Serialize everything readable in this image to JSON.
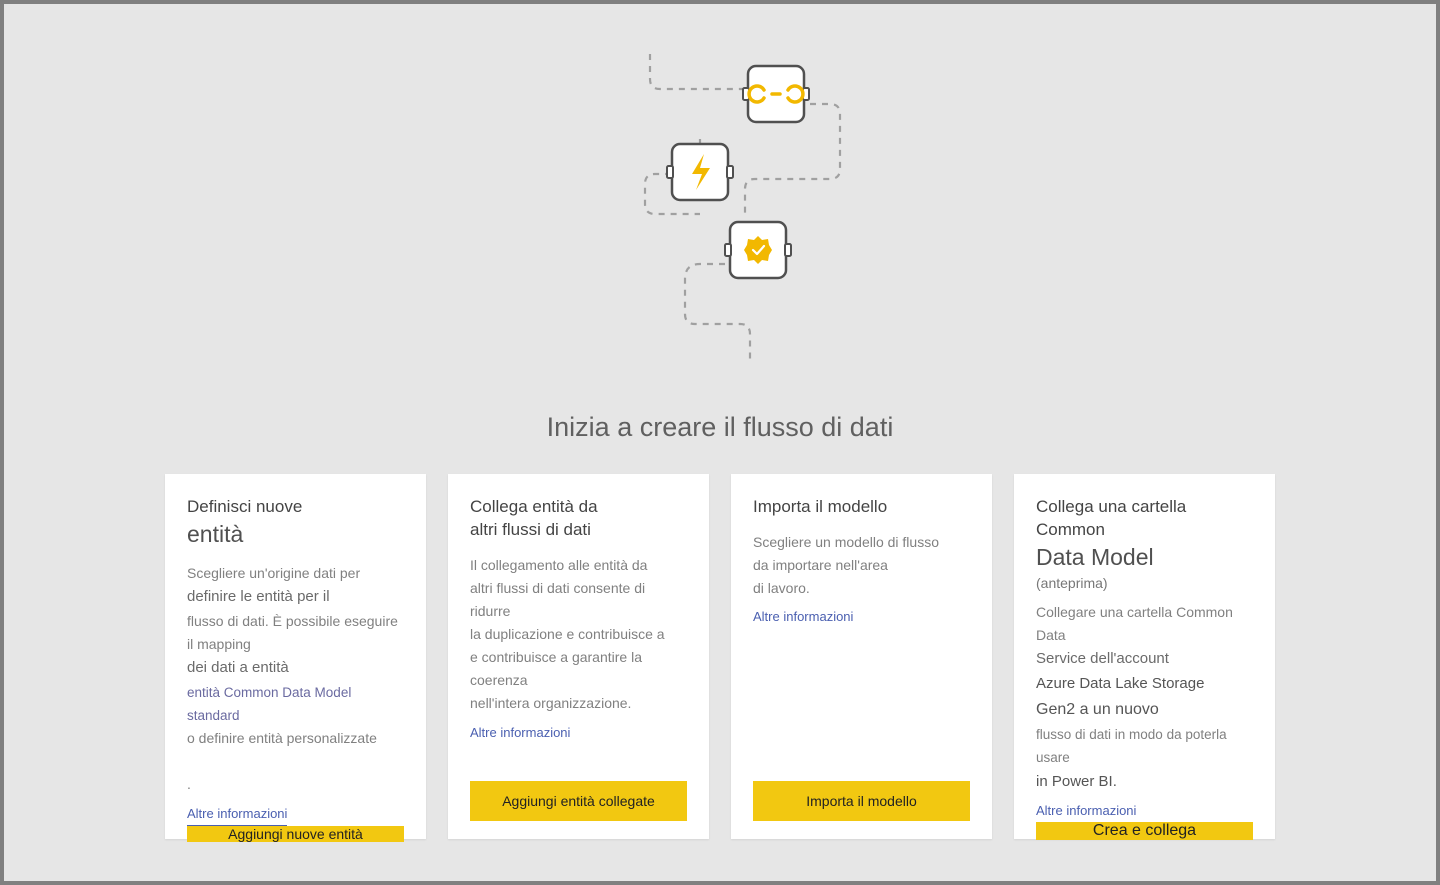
{
  "page_title": "Inizia a creare il flusso di dati",
  "learn_more_label": "Altre informazioni",
  "cards": [
    {
      "title_line1": "Definisci nuove",
      "title_big": "entità",
      "body_line1": "Scegliere un'origine dati per",
      "body_strong1": "definire le entità per il",
      "body_line2": "flusso di dati. È possibile eseguire il mapping",
      "body_entity": "dei dati a entità",
      "body_cds": "entità Common Data Model standard",
      "body_line3": "o definire entità personalizzate",
      "body_dot": ".",
      "button": "Aggiungi nuove entità"
    },
    {
      "title_line1": "Collega entità da",
      "title_line2": "altri flussi di dati",
      "body_line1": "Il collegamento alle entità da",
      "body_line2": "altri flussi di dati consente di ridurre",
      "body_line3": "la duplicazione e contribuisce a",
      "body_line4": "e contribuisce a garantire la coerenza",
      "body_line5": "nell'intera organizzazione.",
      "button": "Aggiungi entità collegate"
    },
    {
      "title": "Importa il modello",
      "body_line1": "Scegliere un modello di flusso",
      "body_line2": "da importare nell'area",
      "body_line3": "di lavoro.",
      "button": "Importa il modello"
    },
    {
      "title_line1": "Collega una cartella Common",
      "title_big": "Data Model",
      "subtitle": "(anteprima)",
      "body_line1": "Collegare una cartella Common Data",
      "body_line2": "Service dell'account",
      "body_storage1": "Azure Data Lake Storage",
      "body_storage2": "Gen2 a un nuovo",
      "body_line3": "flusso di dati in modo da poterla usare",
      "body_line4": "in Power BI.",
      "button": "Crea e collega"
    }
  ],
  "colors": {
    "accent": "#f2c811",
    "link": "#4a5fb0",
    "page_bg": "#e6e6e6"
  }
}
